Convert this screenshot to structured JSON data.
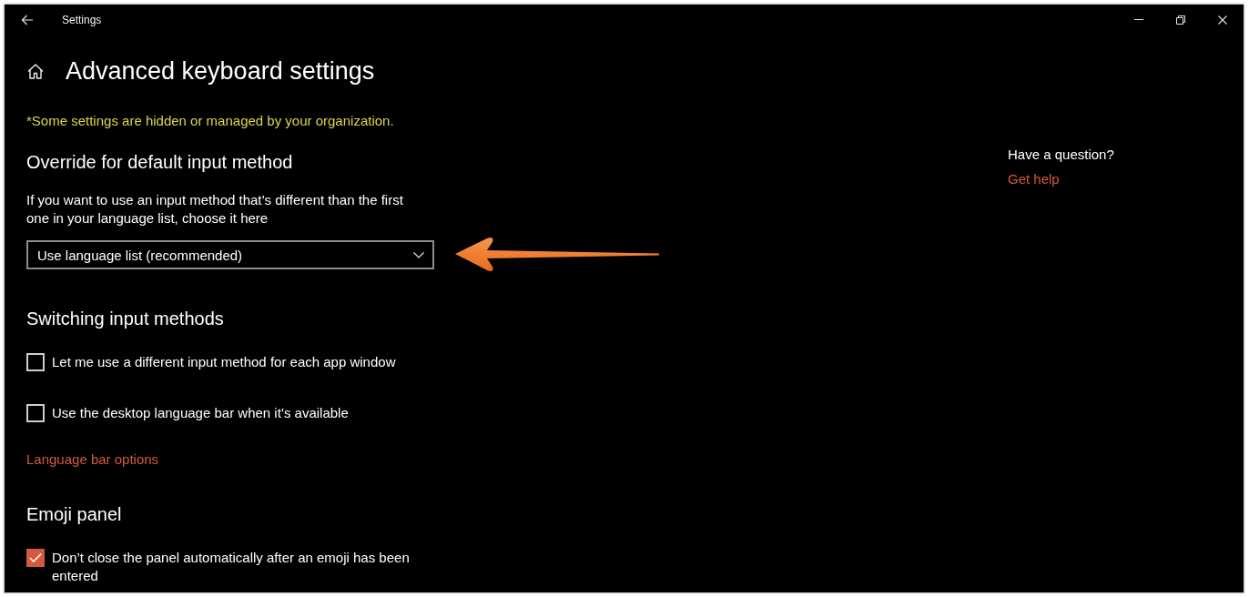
{
  "window": {
    "title": "Settings"
  },
  "page": {
    "title": "Advanced keyboard settings",
    "notice": "*Some settings are hidden or managed by your organization."
  },
  "sections": [
    {
      "heading": "Override for default input method",
      "items": [
        {
          "kind": "description",
          "text": "If you want to use an input method that’s different than the first one in your language list, choose it here"
        },
        {
          "kind": "dropdown",
          "value": "Use language list (recommended)"
        }
      ]
    },
    {
      "heading": "Switching input methods",
      "items": [
        {
          "kind": "checkbox",
          "label": "Let me use a different input method for each app window",
          "checked": false
        },
        {
          "kind": "checkbox",
          "label": "Use the desktop language bar when it’s available",
          "checked": false
        },
        {
          "kind": "link",
          "text": "Language bar options"
        }
      ]
    },
    {
      "heading": "Emoji panel",
      "items": [
        {
          "kind": "checkbox",
          "label": "Don’t close the panel automatically after an emoji has been entered",
          "checked": true
        }
      ]
    }
  ],
  "help": {
    "question": "Have a question?",
    "link": "Get help"
  }
}
